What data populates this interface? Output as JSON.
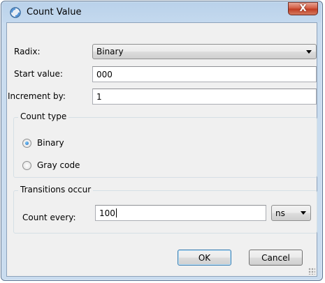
{
  "window": {
    "title": "Count Value",
    "close_label": "X"
  },
  "radix": {
    "label": "Radix:",
    "value": "Binary"
  },
  "start_value": {
    "label": "Start value:",
    "value": "000"
  },
  "increment": {
    "label": "Increment by:",
    "value": "1"
  },
  "count_type": {
    "title": "Count type",
    "options": [
      {
        "label": "Binary",
        "checked": true
      },
      {
        "label": "Gray code",
        "checked": false
      }
    ]
  },
  "transitions": {
    "title": "Transitions occur",
    "count_every_label": "Count every:",
    "count_every_value": "100",
    "unit": "ns"
  },
  "buttons": {
    "ok": "OK",
    "cancel": "Cancel"
  }
}
